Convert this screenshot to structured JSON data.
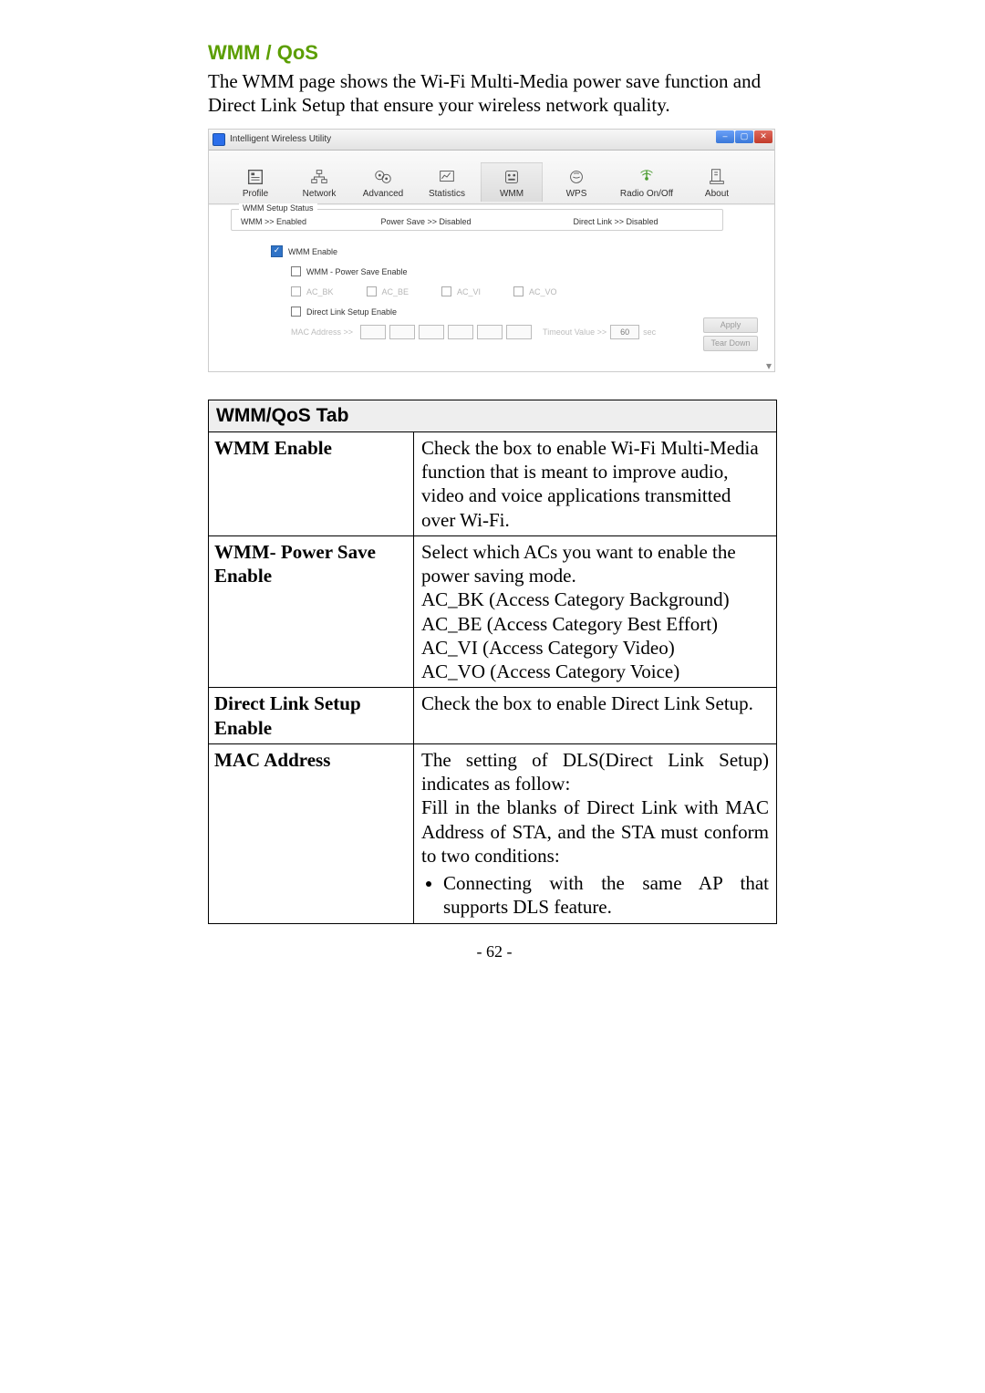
{
  "heading": "WMM / QoS",
  "intro": "The WMM page shows the Wi-Fi Multi-Media power save function and Direct Link Setup that ensure your wireless network quality.",
  "page_number": "- 62 -",
  "shot": {
    "window_title": "Intelligent Wireless Utility",
    "tabs": {
      "profile": "Profile",
      "network": "Network",
      "advanced": "Advanced",
      "statistics": "Statistics",
      "wmm": "WMM",
      "wps": "WPS",
      "radio": "Radio On/Off",
      "about": "About"
    },
    "group_legend": "WMM Setup Status",
    "status": {
      "wmm": "WMM >> Enabled",
      "ps": "Power Save >> Disabled",
      "dls": "Direct Link >> Disabled"
    },
    "options": {
      "wmm_enable": "WMM Enable",
      "ps_enable": "WMM - Power Save Enable",
      "ac_bk": "AC_BK",
      "ac_be": "AC_BE",
      "ac_vi": "AC_VI",
      "ac_vo": "AC_VO",
      "dls_enable": "Direct Link Setup Enable",
      "mac_label": "MAC Address >>",
      "timeout_label": "Timeout Value >>",
      "timeout_value": "60",
      "timeout_unit": "sec",
      "apply": "Apply",
      "teardown": "Tear Down"
    }
  },
  "table": {
    "header": "WMM/QoS Tab",
    "rows": {
      "wmm_enable_k": "WMM Enable",
      "wmm_enable_v": "Check the box to enable Wi-Fi Multi-Media function that is meant to improve audio, video and voice applications transmitted over Wi-Fi.",
      "ps_enable_k": "WMM- Power Save Enable",
      "ps_enable_v_intro": "Select which ACs you want to enable the power saving mode.",
      "ps_ac_bk": "AC_BK (Access Category Background)",
      "ps_ac_be": "AC_BE (Access Category Best Effort)",
      "ps_ac_vi": "AC_VI (Access Category Video)",
      "ps_ac_vo": "AC_VO (Access Category Voice)",
      "dls_enable_k": "Direct Link Setup Enable",
      "dls_enable_v": "Check the box to enable Direct Link Setup.",
      "mac_k": "MAC Address",
      "mac_v_p1": "The setting of DLS(Direct Link Setup) indicates as follow:",
      "mac_v_p2": "Fill in the blanks of Direct Link with MAC Address of STA, and the STA must conform to two conditions:",
      "mac_v_li": "Connecting with the same AP that supports DLS feature."
    }
  }
}
